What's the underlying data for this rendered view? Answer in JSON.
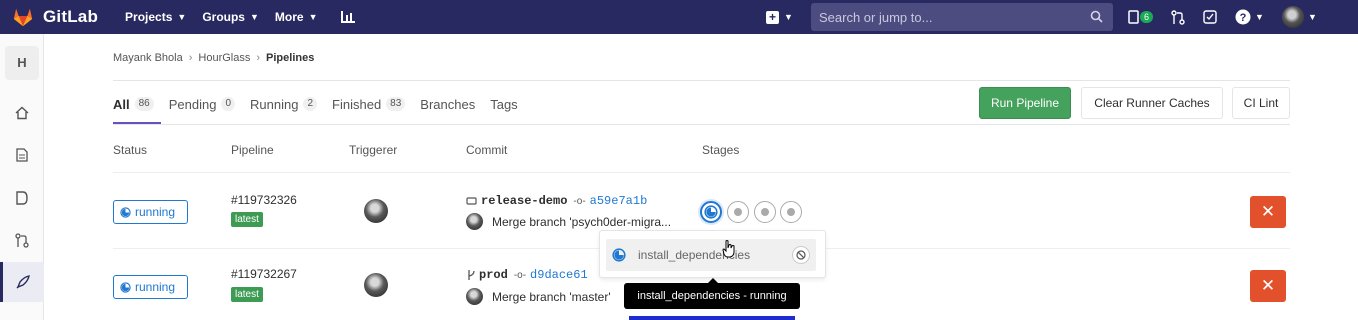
{
  "topbar": {
    "brand": "GitLab",
    "nav": [
      "Projects",
      "Groups",
      "More"
    ],
    "search_placeholder": "Search or jump to...",
    "todo_count": "6",
    "colors": {
      "bar": "#292961",
      "search": "#4c4c80"
    }
  },
  "sidebar": {
    "project_initial": "H",
    "icons": [
      "home-icon",
      "document-icon",
      "issues-icon",
      "merge-request-icon",
      "rocket-icon"
    ]
  },
  "breadcrumb": {
    "items": [
      "Mayank Bhola",
      "HourGlass",
      "Pipelines"
    ]
  },
  "tabs": [
    {
      "label": "All",
      "count": "86"
    },
    {
      "label": "Pending",
      "count": "0"
    },
    {
      "label": "Running",
      "count": "2"
    },
    {
      "label": "Finished",
      "count": "83"
    },
    {
      "label": "Branches",
      "count": ""
    },
    {
      "label": "Tags",
      "count": ""
    }
  ],
  "actions": {
    "run_pipeline": "Run Pipeline",
    "clear_caches": "Clear Runner Caches",
    "ci_lint": "CI Lint"
  },
  "columns": [
    "Status",
    "Pipeline",
    "Triggerer",
    "Commit",
    "Stages"
  ],
  "pipelines": [
    {
      "status": "running",
      "id": "#119732326",
      "badge": "latest",
      "ref": "release-demo",
      "sha": "a59e7a1b",
      "message": "Merge branch 'psych0der-migra..."
    },
    {
      "status": "running",
      "id": "#119732267",
      "badge": "latest",
      "ref": "prod",
      "sha": "d9dace61",
      "message": "Merge branch 'master'"
    }
  ],
  "stage_dropdown": {
    "job": "install_dependencies",
    "tooltip": "install_dependencies - running"
  },
  "colors": {
    "running": "#1f78d1",
    "latest": "#3e9b53",
    "run_pipeline": "#44a25c",
    "cancel": "#e2512c"
  }
}
